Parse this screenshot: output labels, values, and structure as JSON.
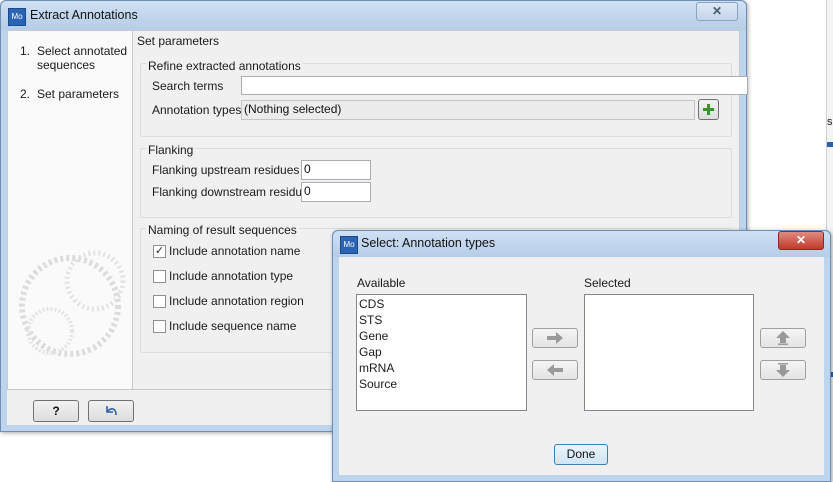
{
  "main_window": {
    "title": "Extract Annotations",
    "app_icon_text": "Mo",
    "steps": [
      {
        "number": "1.",
        "label": "Select annotated"
      },
      {
        "number": "",
        "label": "sequences"
      },
      {
        "number": "2.",
        "label": "Set parameters"
      }
    ],
    "panel_title": "Set parameters",
    "refine": {
      "title": "Refine extracted annotations",
      "search_label": "Search terms",
      "search_value": "",
      "types_label": "Annotation types",
      "types_value": "(Nothing selected)"
    },
    "flanking": {
      "title": "Flanking",
      "upstream_label": "Flanking upstream residues",
      "upstream_value": "0",
      "downstream_label": "Flanking downstream residues",
      "downstream_value": "0"
    },
    "naming": {
      "title": "Naming of result sequences",
      "options": [
        {
          "label": "Include annotation name",
          "checked": "✓"
        },
        {
          "label": "Include annotation type",
          "checked": ""
        },
        {
          "label": "Include annotation region",
          "checked": ""
        },
        {
          "label": "Include sequence name",
          "checked": ""
        }
      ]
    },
    "help_button": "?",
    "back_button_icon": "undo-arrow-icon"
  },
  "dialog": {
    "title": "Select: Annotation types",
    "app_icon_text": "Mo",
    "available_label": "Available",
    "selected_label": "Selected",
    "available_items": [
      "CDS",
      "STS",
      "Gene",
      "Gap",
      "mRNA",
      "Source"
    ],
    "selected_items": [],
    "done_button": "Done"
  },
  "colors": {
    "title_bar": "#bcd4ec",
    "close_button": "#c9463d",
    "add_icon": "#2e9a2e"
  },
  "background_fragment": "s"
}
